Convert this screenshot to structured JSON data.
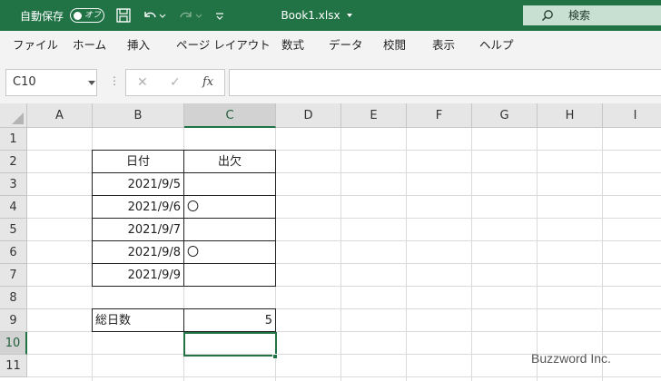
{
  "titlebar": {
    "autosave_label": "自動保存",
    "autosave_state": "オフ",
    "file_name": "Book1.xlsx",
    "search_placeholder": "検索",
    "accent_color": "#217346"
  },
  "menu": {
    "items": [
      "ファイル",
      "ホーム",
      "挿入",
      "ページ レイアウト",
      "数式",
      "データ",
      "校閲",
      "表示",
      "ヘルプ"
    ]
  },
  "formula_bar": {
    "name_box": "C10",
    "fx_label": "fx",
    "cancel_icon": "✕",
    "enter_icon": "✓",
    "formula": ""
  },
  "sheet": {
    "columns": [
      "A",
      "B",
      "C",
      "D",
      "E",
      "F",
      "G",
      "H",
      "I"
    ],
    "rows": [
      "1",
      "2",
      "3",
      "4",
      "5",
      "6",
      "7",
      "8",
      "9",
      "10",
      "11"
    ],
    "active_cell": "C10",
    "cells": {
      "B2": "日付",
      "C2": "出欠",
      "B3": "2021/9/5",
      "B4": "2021/9/6",
      "C4": "〇",
      "B5": "2021/9/7",
      "B6": "2021/9/8",
      "C6": "〇",
      "B7": "2021/9/9",
      "B9": "総日数",
      "C9": "5"
    }
  },
  "watermark": "Buzzword Inc."
}
